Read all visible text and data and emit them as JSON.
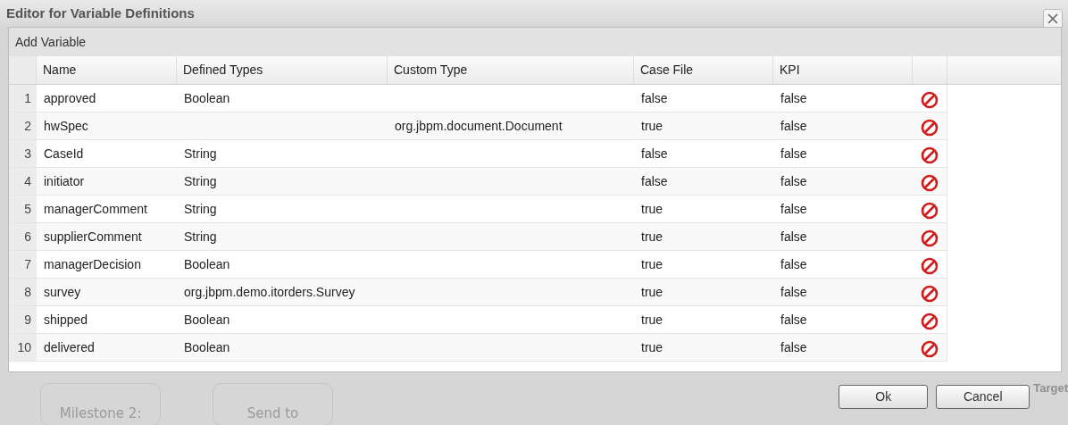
{
  "dialog": {
    "title": "Editor for Variable Definitions"
  },
  "panel": {
    "title": "Add Variable"
  },
  "table": {
    "columns": [
      "Name",
      "Defined Types",
      "Custom Type",
      "Case File",
      "KPI"
    ],
    "rows": [
      {
        "index": "1",
        "name": "approved",
        "defined_type": "Boolean",
        "custom_type": "",
        "case_file": "false",
        "kpi": "false"
      },
      {
        "index": "2",
        "name": "hwSpec",
        "defined_type": "",
        "custom_type": "org.jbpm.document.Document",
        "case_file": "true",
        "kpi": "false"
      },
      {
        "index": "3",
        "name": "CaseId",
        "defined_type": "String",
        "custom_type": "",
        "case_file": "false",
        "kpi": "false"
      },
      {
        "index": "4",
        "name": "initiator",
        "defined_type": "String",
        "custom_type": "",
        "case_file": "false",
        "kpi": "false"
      },
      {
        "index": "5",
        "name": "managerComment",
        "defined_type": "String",
        "custom_type": "",
        "case_file": "true",
        "kpi": "false"
      },
      {
        "index": "6",
        "name": "supplierComment",
        "defined_type": "String",
        "custom_type": "",
        "case_file": "true",
        "kpi": "false"
      },
      {
        "index": "7",
        "name": "managerDecision",
        "defined_type": "Boolean",
        "custom_type": "",
        "case_file": "true",
        "kpi": "false"
      },
      {
        "index": "8",
        "name": "survey",
        "defined_type": "org.jbpm.demo.itorders.Survey",
        "custom_type": "",
        "case_file": "true",
        "kpi": "false"
      },
      {
        "index": "9",
        "name": "shipped",
        "defined_type": "Boolean",
        "custom_type": "",
        "case_file": "true",
        "kpi": "false"
      },
      {
        "index": "10",
        "name": "delivered",
        "defined_type": "Boolean",
        "custom_type": "",
        "case_file": "true",
        "kpi": "false"
      }
    ]
  },
  "background": {
    "nodes": [
      "Milestone 2:",
      "Send to"
    ],
    "side_label": "Target"
  },
  "buttons": [
    "Ok",
    "Cancel"
  ]
}
